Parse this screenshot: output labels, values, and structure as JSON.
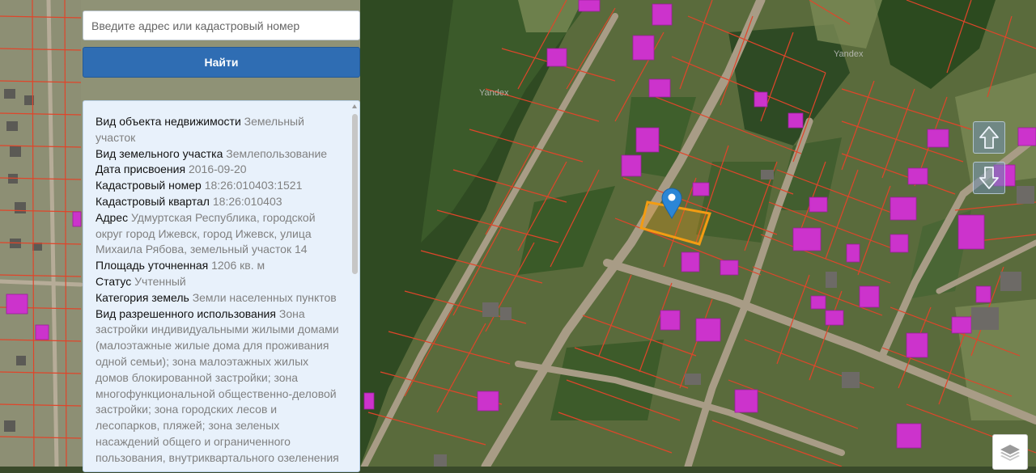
{
  "search": {
    "placeholder": "Введите адрес или кадастровый номер",
    "value": "",
    "button_label": "Найти"
  },
  "info": {
    "fields": [
      {
        "key": "Вид объекта недвижимости",
        "value": "Земельный участок"
      },
      {
        "key": "Вид земельного участка",
        "value": "Землепользование"
      },
      {
        "key": "Дата присвоения",
        "value": "2016-09-20"
      },
      {
        "key": "Кадастровый номер",
        "value": "18:26:010403:1521"
      },
      {
        "key": "Кадастровый квартал",
        "value": "18:26:010403"
      },
      {
        "key": "Адрес",
        "value": "Удмуртская Республика, городской округ город Ижевск, город Ижевск, улица Михаила Рябова, земельный участок 14"
      },
      {
        "key": "Площадь уточненная",
        "value": "1206 кв. м"
      },
      {
        "key": "Статус",
        "value": "Учтенный"
      },
      {
        "key": "Категория земель",
        "value": "Земли населенных пунктов"
      },
      {
        "key": "Вид разрешенного использования",
        "value": "Зона застройки индивидуальными жилыми домами (малоэтажные жилые дома для проживания одной семьи); зона малоэтажных жилых домов блокированной застройки; зона многофункциональной общественно-деловой застройки; зона городских лесов и лесопарков, пляжей; зона зеленых насаждений общего и ограниченного пользования, внутриквартального озеленения"
      }
    ]
  },
  "map": {
    "watermarks": [
      "Yandex",
      "Yandex"
    ],
    "colors": {
      "parcel_border": "#e0452a",
      "selected_parcel": "#f39c12",
      "building": "#cc33cc",
      "marker": "#2b86d6",
      "road": "#a89c86"
    },
    "controls": [
      "arrow-up-icon",
      "arrow-down-icon",
      "layers-icon"
    ]
  }
}
